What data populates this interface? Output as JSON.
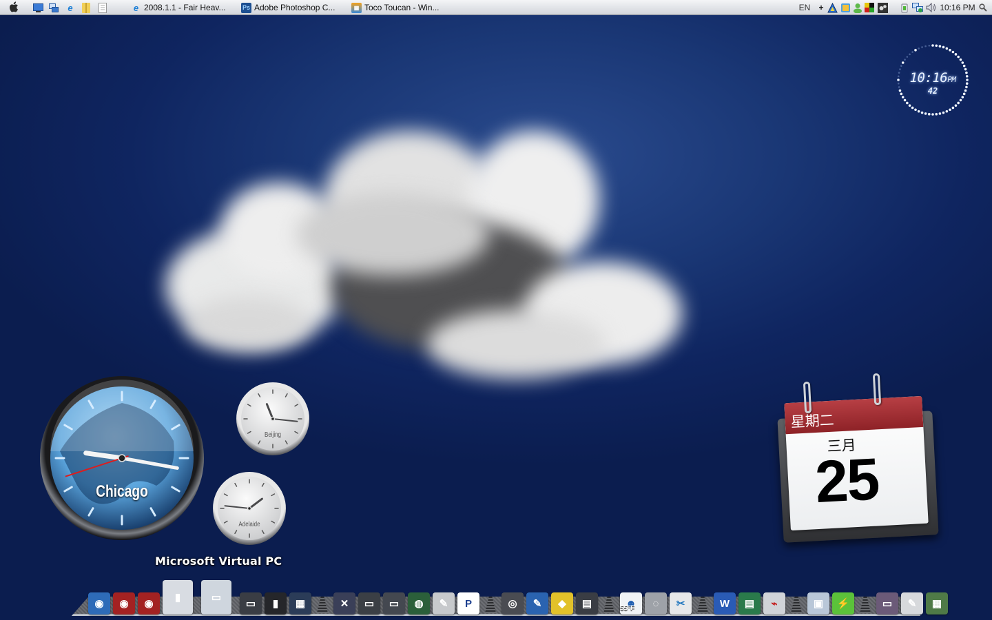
{
  "taskbar": {
    "start_icon": "apple-logo-icon",
    "quick_launch": [
      {
        "name": "show-desktop-icon",
        "glyph": "▭"
      },
      {
        "name": "switch-windows-icon",
        "glyph": "⧉"
      },
      {
        "name": "internet-explorer-icon",
        "glyph": "e"
      },
      {
        "name": "folder-icon",
        "glyph": "▮"
      },
      {
        "name": "document-icon",
        "glyph": "▤"
      }
    ],
    "tasks": [
      {
        "icon": "internet-explorer-icon",
        "badge": "e",
        "label": "2008.1.1 - Fair Heav..."
      },
      {
        "icon": "photoshop-icon",
        "badge": "Ps",
        "label": "Adobe Photoshop C..."
      },
      {
        "icon": "windows-live-icon",
        "badge": "▦",
        "label": "Toco Toucan - Win..."
      }
    ],
    "tray": {
      "language": "EN",
      "icons": [
        {
          "name": "add-icon",
          "glyph": "+"
        },
        {
          "name": "network-app-icon",
          "glyph": "▲"
        },
        {
          "name": "photo-gallery-icon",
          "glyph": "▣"
        },
        {
          "name": "messenger-user-icon",
          "glyph": "●"
        },
        {
          "name": "color-blocks-icon",
          "glyph": "■"
        },
        {
          "name": "gears-icon",
          "glyph": "⚙"
        },
        {
          "name": "power-plug-icon",
          "glyph": "⏚"
        },
        {
          "name": "network-connection-icon",
          "glyph": "⧉"
        },
        {
          "name": "volume-icon",
          "glyph": "🔊"
        }
      ],
      "clock": "10:16 PM",
      "search_icon": "magnifier-icon"
    }
  },
  "widgets": {
    "digital_clock": {
      "time": "10:16",
      "ampm": "PM",
      "seconds": "42"
    },
    "world_clocks": [
      {
        "city": "Chicago",
        "hour": 9,
        "minute": 16,
        "second": 42
      },
      {
        "city": "Beijing",
        "hour": 11,
        "minute": 16
      },
      {
        "city": "Adelaide",
        "hour": 1,
        "minute": 46
      }
    ],
    "calendar": {
      "weekday": "星期二",
      "month": "三月",
      "day": "25"
    }
  },
  "dock": {
    "hover_label": "Microsoft Virtual PC",
    "weather_temp": "55°F",
    "items": [
      {
        "name": "network-drive-blue",
        "glyph": "◉",
        "color": "#2e6bb8"
      },
      {
        "name": "network-drive-red",
        "glyph": "◉",
        "color": "#a32222"
      },
      {
        "name": "network-drive-red-2",
        "glyph": "◉",
        "color": "#a32222"
      },
      {
        "name": "virtual-pc-towers",
        "glyph": "▮",
        "color": "#d8dce2"
      },
      {
        "name": "virtual-pc-monitors",
        "glyph": "▭",
        "color": "#cfd6de"
      },
      {
        "name": "display-monitors",
        "glyph": "▭",
        "color": "#3a3d44"
      },
      {
        "name": "server-rack",
        "glyph": "▮",
        "color": "#25262a"
      },
      {
        "name": "memory-chip",
        "glyph": "▦",
        "color": "#2b3c58"
      },
      {
        "sep": true
      },
      {
        "name": "system-tools",
        "glyph": "✕",
        "color": "#3a3f58"
      },
      {
        "name": "monitor-app",
        "glyph": "▭",
        "color": "#3b3f45"
      },
      {
        "name": "monitor-app-2",
        "glyph": "▭",
        "color": "#444850"
      },
      {
        "name": "globe-app",
        "glyph": "◍",
        "color": "#2b5f3a"
      },
      {
        "name": "pencil-app",
        "glyph": "✎",
        "color": "#c7c9cc"
      },
      {
        "name": "p-app",
        "glyph": "P",
        "color": "#ffffff",
        "text": "#1c3f8f"
      },
      {
        "sep": true
      },
      {
        "name": "film-reel-app",
        "glyph": "◎",
        "color": "#4a4c52"
      },
      {
        "name": "paint-app",
        "glyph": "✎",
        "color": "#2a63b0"
      },
      {
        "name": "road-sign-app",
        "glyph": "◆",
        "color": "#e2c12a"
      },
      {
        "name": "tools-app",
        "glyph": "▤",
        "color": "#3a3d44"
      },
      {
        "sep": true
      },
      {
        "name": "messenger-buddy",
        "glyph": "☻",
        "color": "#f0f3f6",
        "text": "#1b5bb0"
      },
      {
        "name": "weather-app",
        "glyph": "◌",
        "color": "#9ea2a8"
      },
      {
        "name": "scissors-app",
        "glyph": "✂",
        "color": "#e7e8ea",
        "text": "#2a7bc0"
      },
      {
        "sep": true
      },
      {
        "name": "word-app",
        "glyph": "W",
        "color": "#2a5bb5"
      },
      {
        "name": "excel-publisher-app",
        "glyph": "▤",
        "color": "#2a7a4b"
      },
      {
        "name": "acrobat-app",
        "glyph": "⌁",
        "color": "#d0d3d8",
        "text": "#c41b1b"
      },
      {
        "sep": true
      },
      {
        "name": "installer-box",
        "glyph": "▣",
        "color": "#b9c7d8"
      },
      {
        "name": "battery-app",
        "glyph": "⚡",
        "color": "#5bc23a"
      },
      {
        "sep": true
      },
      {
        "name": "photo-viewer",
        "glyph": "▭",
        "color": "#6b5a78"
      },
      {
        "name": "tools-pencil",
        "glyph": "✎",
        "color": "#d7d9dc"
      },
      {
        "name": "map-app",
        "glyph": "▦",
        "color": "#4f7a47"
      }
    ]
  },
  "colors": {
    "sky": "#1a3775",
    "taskbar": "#e3e5e9",
    "calendar_header": "#a23236"
  }
}
